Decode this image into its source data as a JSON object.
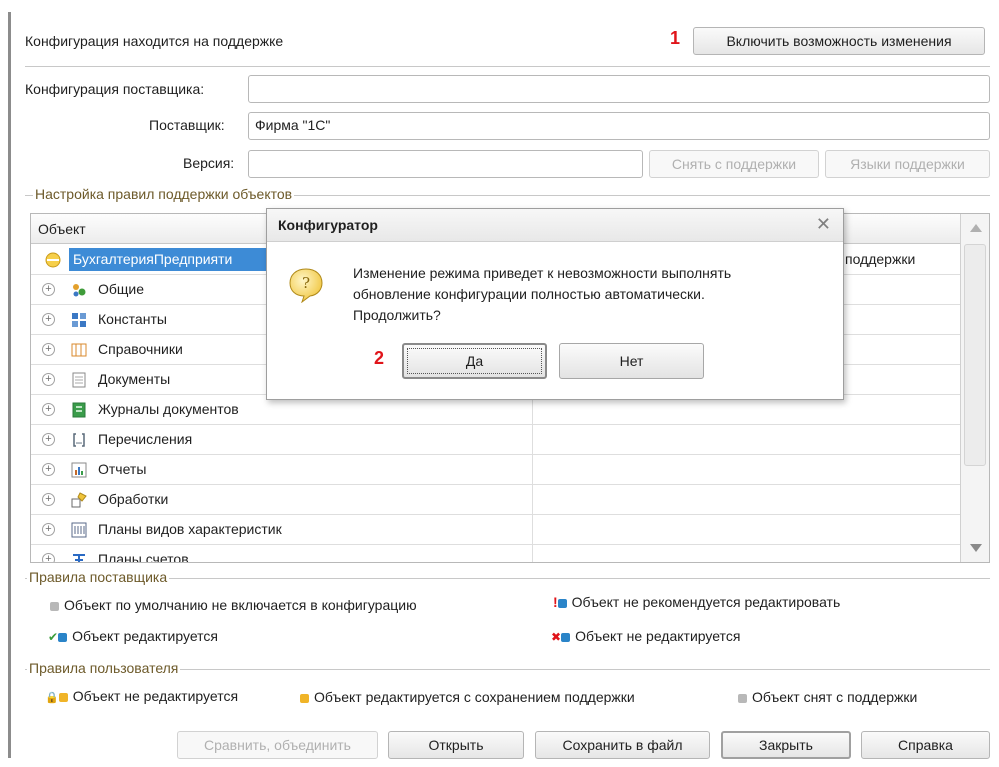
{
  "header": {
    "status_text": "Конфигурация находится на поддержке",
    "enable_button": "Включить возможность изменения",
    "marker1": "1"
  },
  "fields": {
    "vendor_config_label": "Конфигурация поставщика:",
    "vendor_config_value": "",
    "supplier_label": "Поставщик:",
    "supplier_value": "Фирма \"1С\"",
    "version_label": "Версия:",
    "version_value": "",
    "remove_support_button": "Снять с поддержки",
    "support_languages_button": "Языки поддержки"
  },
  "rules_group": {
    "title": "Настройка правил поддержки объектов",
    "column_object": "Объект",
    "rows": [
      {
        "label": "БухгалтерияПредприяти",
        "right": "поддержки",
        "icon": "config-icon",
        "color": "#f2c23a"
      },
      {
        "label": "Общие",
        "right": "",
        "icon": "common-icon",
        "color": "#3f9c3a"
      },
      {
        "label": "Константы",
        "right": "",
        "icon": "constants-icon",
        "color": "#3b78c4"
      },
      {
        "label": "Справочники",
        "right": "",
        "icon": "catalogs-icon",
        "color": "#d88a2c"
      },
      {
        "label": "Документы",
        "right": "",
        "icon": "documents-icon",
        "color": "#8a8a8a"
      },
      {
        "label": "Журналы документов",
        "right": "",
        "icon": "journals-icon",
        "color": "#3a9c4a"
      },
      {
        "label": "Перечисления",
        "right": "",
        "icon": "enums-icon",
        "color": "#5a6a7a"
      },
      {
        "label": "Отчеты",
        "right": "",
        "icon": "reports-icon",
        "color": "#c46a2a"
      },
      {
        "label": "Обработки",
        "right": "",
        "icon": "processings-icon",
        "color": "#d8b12c"
      },
      {
        "label": "Планы видов характеристик",
        "right": "",
        "icon": "characteristics-icon",
        "color": "#5a6a8a"
      },
      {
        "label": "Планы счетов",
        "right": "",
        "icon": "accounts-icon",
        "color": "#2a6ac4"
      }
    ]
  },
  "supplier_rules": {
    "title": "Правила поставщика",
    "not_included": "Объект по умолчанию не включается в конфигурацию",
    "not_recommended": "Объект не рекомендуется редактировать",
    "editable": "Объект редактируется",
    "not_editable": "Объект не редактируется"
  },
  "user_rules": {
    "title": "Правила пользователя",
    "not_editable": "Объект не редактируется",
    "editable_keep": "Объект редактируется с сохранением поддержки",
    "removed": "Объект снят с поддержки"
  },
  "footer": {
    "compare_merge": "Сравнить, объединить",
    "open": "Открыть",
    "save_to_file": "Сохранить в файл",
    "close": "Закрыть",
    "help": "Справка"
  },
  "dialog": {
    "title": "Конфигуратор",
    "line1": "Изменение режима приведет к невозможности выполнять",
    "line2": "обновление конфигурации полностью автоматически.",
    "line3": "Продолжить?",
    "yes": "Да",
    "no": "Нет",
    "marker2": "2"
  },
  "colors": {
    "accent_selection": "#3d8bd6",
    "marker": "#e0141a",
    "group_title": "#6d5a2a"
  }
}
